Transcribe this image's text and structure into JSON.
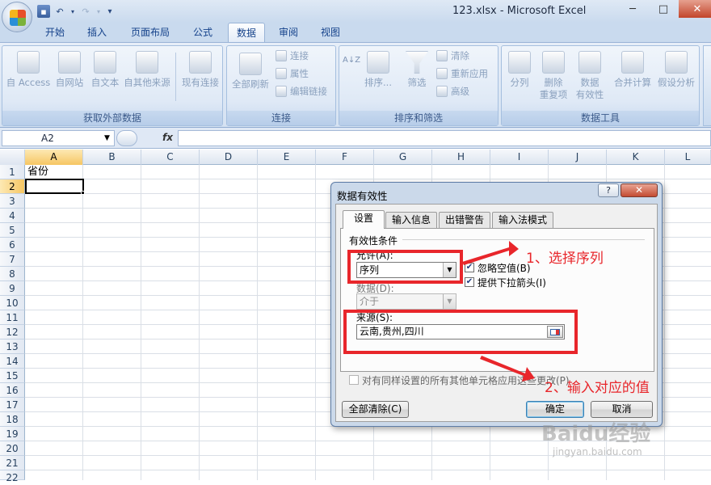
{
  "window": {
    "title": "123.xlsx - Microsoft Excel",
    "minimize_glyph": "─",
    "maximize_glyph": "□",
    "close_glyph": "✕"
  },
  "qat": {
    "save_icon": "save-icon",
    "undo_icon": "undo-icon",
    "redo_icon": "redo-icon",
    "customize_glyph": "▾"
  },
  "ribbon_tabs": [
    "开始",
    "插入",
    "页面布局",
    "公式",
    "数据",
    "审阅",
    "视图"
  ],
  "active_tab": "数据",
  "groups": {
    "external": {
      "label": "获取外部数据",
      "buttons": [
        "自 Access",
        "自网站",
        "自文本",
        "自其他来源",
        "现有连接"
      ]
    },
    "connections": {
      "label": "连接",
      "refresh_all": "全部刷新",
      "items": [
        "连接",
        "属性",
        "编辑链接"
      ]
    },
    "sort_filter": {
      "label": "排序和筛选",
      "sort": "排序...",
      "filter": "筛选",
      "items": [
        "清除",
        "重新应用",
        "高级"
      ]
    },
    "data_tools": {
      "label": "数据工具",
      "buttons": [
        "分列",
        "删除\n重复项",
        "数据\n有效性",
        "合并计算",
        "假设分析"
      ]
    }
  },
  "formula_bar": {
    "name_box": "A2",
    "fx_label": "fx",
    "formula": ""
  },
  "columns": [
    "A",
    "B",
    "C",
    "D",
    "E",
    "F",
    "G",
    "H",
    "I",
    "J",
    "K",
    "L"
  ],
  "rows": [
    "1",
    "2",
    "3",
    "4",
    "5",
    "6",
    "7",
    "8",
    "9",
    "10",
    "11",
    "12",
    "13",
    "14",
    "15",
    "16",
    "17",
    "18",
    "19",
    "20",
    "21",
    "22"
  ],
  "cells": {
    "A1": "省份"
  },
  "selected_cell": "A2",
  "dialog": {
    "title": "数据有效性",
    "help_glyph": "?",
    "close_glyph": "✕",
    "tabs": [
      "设置",
      "输入信息",
      "出错警告",
      "输入法模式"
    ],
    "active_tab": "设置",
    "section_label": "有效性条件",
    "allow_label": "允许(A):",
    "allow_value": "序列",
    "ignore_blank_label": "忽略空值(B)",
    "ignore_blank_checked": true,
    "dropdown_label": "提供下拉箭头(I)",
    "dropdown_checked": true,
    "data_label": "数据(D):",
    "data_value": "介于",
    "source_label": "来源(S):",
    "source_value": "云南,贵州,四川",
    "apply_all_label": "对有同样设置的所有其他单元格应用这些更改(P)",
    "apply_all_checked": false,
    "clear_all_button": "全部清除(C)",
    "ok_button": "确定",
    "cancel_button": "取消"
  },
  "annotations": {
    "step1": "1、选择序列",
    "step2": "2、输入对应的值",
    "color": "#e8262b"
  },
  "watermark": {
    "logo": "Baidu经验",
    "url": "jingyan.baidu.com"
  }
}
